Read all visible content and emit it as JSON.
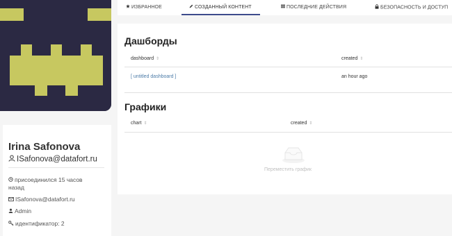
{
  "colors": {
    "avatar_bg": "#2b2943",
    "avatar_fg": "#c7c860",
    "tab_accent": "#3d4b8c",
    "link": "#4a7aa7"
  },
  "profile": {
    "name": "Irina Safonova",
    "login": "ISafonova@datafort.ru",
    "joined": "присоединился 15 часов назад",
    "email": "ISafonova@datafort.ru",
    "role": "Admin",
    "id_label": "идентификатор: 2"
  },
  "tabs": [
    {
      "icon": "star-icon",
      "label": "ИЗБРАННОЕ"
    },
    {
      "icon": "pencil-icon",
      "label": "СОЗДАННЫЙ КОНТЕНТ",
      "active": true
    },
    {
      "icon": "list-icon",
      "label": "ПОСЛЕДНИЕ ДЕЙСТВИЯ"
    },
    {
      "icon": "lock-icon",
      "label": "БЕЗОПАСНОСТЬ И ДОСТУП"
    }
  ],
  "dashboards": {
    "title": "Дашборды",
    "columns": [
      "dashboard",
      "created"
    ],
    "rows": [
      {
        "name": "[ untitled dashboard ]",
        "created": "an hour ago"
      }
    ]
  },
  "charts": {
    "title": "Графики",
    "columns": [
      "chart",
      "created"
    ],
    "empty_text": "Переместить график"
  }
}
